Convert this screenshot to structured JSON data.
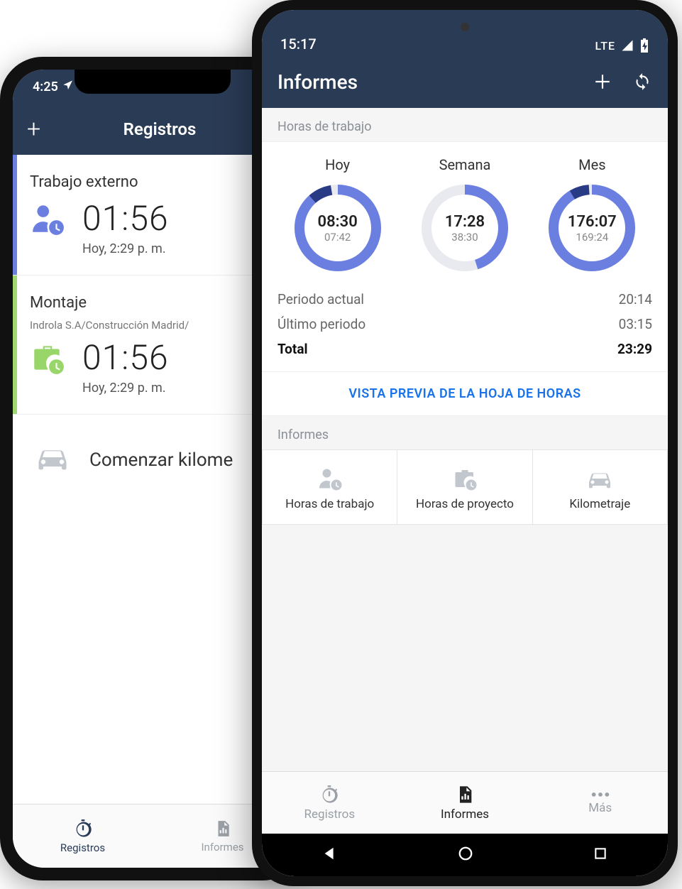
{
  "iphone": {
    "status_time": "4:25",
    "header_title": "Registros",
    "items": [
      {
        "label": "Trabajo externo",
        "sub": "",
        "time": "01:56",
        "meta": "Hoy, 2:29 p. m."
      },
      {
        "label": "Montaje",
        "sub": "Indrola S.A/Construcción Madrid/",
        "time": "01:56",
        "meta": "Hoy, 2:29 p. m."
      }
    ],
    "km_label": "Comenzar kilome",
    "tabs": {
      "registros": "Registros",
      "informes": "Informes"
    }
  },
  "android": {
    "status_time": "15:17",
    "status_net": "LTE",
    "header_title": "Informes",
    "section_work": "Horas de trabajo",
    "gauges": [
      {
        "title": "Hoy",
        "big": "08:30",
        "small": "07:42",
        "pct": 0.95
      },
      {
        "title": "Semana",
        "big": "17:28",
        "small": "38:30",
        "pct": 0.45
      },
      {
        "title": "Mes",
        "big": "176:07",
        "small": "169:24",
        "pct": 0.97
      }
    ],
    "stats": {
      "current_label": "Periodo actual",
      "current_val": "20:14",
      "last_label": "Último periodo",
      "last_val": "03:15",
      "total_label": "Total",
      "total_val": "23:29"
    },
    "preview_link": "VISTA PREVIA DE LA HOJA DE HORAS",
    "section_reports": "Informes",
    "tiles": {
      "work": "Horas de trabajo",
      "project": "Horas de proyecto",
      "mileage": "Kilometraje"
    },
    "tabs": {
      "registros": "Registros",
      "informes": "Informes",
      "mas": "Más"
    }
  }
}
